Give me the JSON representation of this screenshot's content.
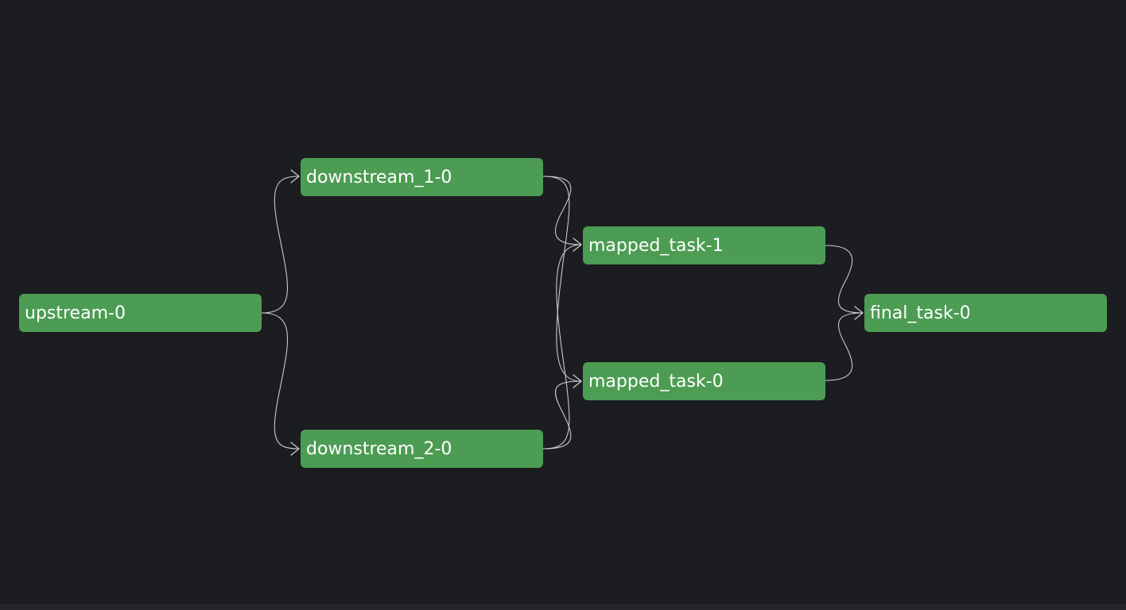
{
  "diagram": {
    "colors": {
      "background": "#1c1d21",
      "node_fill": "#4c9c53",
      "node_text": "#ffffff",
      "edge": "#c9c9c9"
    },
    "nodes": {
      "upstream": "upstream-0",
      "downstream_1": "downstream_1-0",
      "downstream_2": "downstream_2-0",
      "mapped_task_1": "mapped_task-1",
      "mapped_task_0": "mapped_task-0",
      "final_task": "final_task-0"
    },
    "edges": [
      {
        "from": "upstream-0",
        "to": "downstream_1-0"
      },
      {
        "from": "upstream-0",
        "to": "downstream_2-0"
      },
      {
        "from": "downstream_1-0",
        "to": "mapped_task-1"
      },
      {
        "from": "downstream_1-0",
        "to": "mapped_task-0"
      },
      {
        "from": "downstream_2-0",
        "to": "mapped_task-1"
      },
      {
        "from": "downstream_2-0",
        "to": "mapped_task-0"
      },
      {
        "from": "mapped_task-1",
        "to": "final_task-0"
      },
      {
        "from": "mapped_task-0",
        "to": "final_task-0"
      }
    ]
  }
}
